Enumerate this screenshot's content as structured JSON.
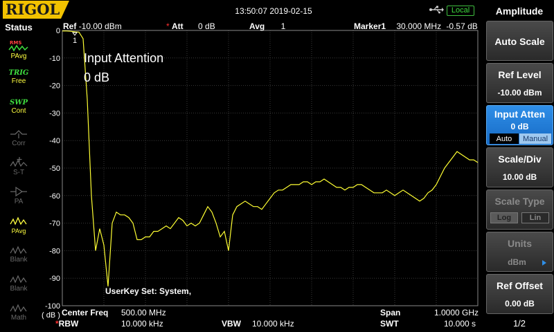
{
  "header": {
    "logo": "RIGOL",
    "datetime": "13:50:07 2019-02-15",
    "local": "Local",
    "ref_label": "Ref",
    "ref_value": "-10.00 dBm",
    "att_label": "Att",
    "att_value": "0 dB",
    "avg_label": "Avg",
    "avg_value": "1",
    "marker_label": "Marker1",
    "marker_freq": "30.000 MHz",
    "marker_amp": "-0.57 dB"
  },
  "status": {
    "title": "Status",
    "items": [
      {
        "top": "",
        "bottom": "PAvg",
        "icon": "rms-wave-icon",
        "active": true
      },
      {
        "top": "TRIG",
        "bottom": "Free",
        "icon": "",
        "active": true
      },
      {
        "top": "SWP",
        "bottom": "Cont",
        "icon": "",
        "active": true
      },
      {
        "top": "",
        "bottom": "Corr",
        "icon": "corr-icon",
        "active": false
      },
      {
        "top": "",
        "bottom": "S-T",
        "icon": "st-icon",
        "active": false
      },
      {
        "top": "",
        "bottom": "PA",
        "icon": "pa-icon",
        "active": false
      },
      {
        "top": "",
        "bottom": "PAvg",
        "icon": "pavg-icon",
        "active": true
      },
      {
        "top": "",
        "bottom": "Blank",
        "icon": "blank-icon",
        "active": false
      },
      {
        "top": "",
        "bottom": "Blank",
        "icon": "blank-icon",
        "active": false
      },
      {
        "top": "",
        "bottom": "Math",
        "icon": "math-icon",
        "active": false
      }
    ],
    "rms_text": "RMS"
  },
  "plot": {
    "y_ticks": [
      "0",
      "-10",
      "-20",
      "-30",
      "-40",
      "-50",
      "-60",
      "-70",
      "-80",
      "-90",
      "-100"
    ],
    "y_unit": "( dB )",
    "marker_num": "1",
    "annotation_title": "Input Attention",
    "annotation_value": "0 dB",
    "userkey": "UserKey Set:   System,"
  },
  "chart_data": {
    "type": "line",
    "ylim": [
      -100,
      0
    ],
    "xlim": [
      0,
      1000
    ],
    "x_unit": "MHz",
    "series": [
      {
        "x": [
          0,
          10,
          20,
          30,
          40,
          50,
          60,
          70,
          80,
          90,
          100,
          110,
          120,
          130,
          140,
          150,
          160,
          170,
          180,
          190,
          200,
          210,
          220,
          230,
          240,
          250,
          260,
          270,
          280,
          290,
          300,
          310,
          320,
          330,
          340,
          350,
          360,
          370,
          380,
          390,
          400,
          410,
          420,
          430,
          440,
          450,
          460,
          470,
          480,
          490,
          500,
          510,
          520,
          530,
          540,
          550,
          560,
          570,
          580,
          590,
          600,
          610,
          620,
          630,
          640,
          650,
          660,
          670,
          680,
          690,
          700,
          710,
          720,
          730,
          740,
          750,
          760,
          770,
          780,
          790,
          800,
          810,
          820,
          830,
          840,
          850,
          860,
          870,
          880,
          890,
          900,
          910,
          920,
          930,
          940,
          950,
          960,
          970,
          980,
          990,
          1000
        ],
        "y": [
          -0.2,
          -0.2,
          -0.3,
          -0.5,
          -0.6,
          -3,
          -25,
          -60,
          -80,
          -72,
          -78,
          -93,
          -70,
          -66,
          -67,
          -67,
          -68,
          -70,
          -76,
          -76,
          -75,
          -75,
          -73,
          -73,
          -72,
          -71,
          -72,
          -70,
          -68,
          -69,
          -71,
          -70,
          -71,
          -70,
          -67,
          -64,
          -66,
          -70,
          -75,
          -73,
          -80,
          -67,
          -64,
          -63,
          -62,
          -63,
          -64,
          -64,
          -65,
          -63,
          -61,
          -59,
          -58,
          -58,
          -57,
          -56,
          -56,
          -56,
          -55,
          -55,
          -56,
          -55,
          -55,
          -54,
          -55,
          -56,
          -57,
          -57,
          -58,
          -57,
          -57,
          -56,
          -56,
          -57,
          -58,
          -59,
          -59,
          -59,
          -58,
          -59,
          -60,
          -59,
          -58,
          -59,
          -60,
          -61,
          -62,
          -61,
          -59,
          -58,
          -56,
          -53,
          -50,
          -48,
          -46,
          -44,
          -45,
          -46,
          -47,
          -47,
          -48
        ]
      }
    ]
  },
  "bottom": {
    "center_label": "Center Freq",
    "center_value": "500.00 MHz",
    "span_label": "Span",
    "span_value": "1.0000 GHz",
    "rbw_label": "RBW",
    "rbw_value": "10.000 kHz",
    "vbw_label": "VBW",
    "vbw_value": "10.000 kHz",
    "swt_label": "SWT",
    "swt_value": "10.000 s"
  },
  "menu": {
    "title": "Amplitude",
    "auto_scale": "Auto Scale",
    "ref_level": "Ref Level",
    "ref_level_value": "-10.00 dBm",
    "input_atten": "Input Atten",
    "input_atten_value": "0 dB",
    "atten_auto": "Auto",
    "atten_manual": "Manual",
    "scale_div": "Scale/Div",
    "scale_div_value": "10.00 dB",
    "scale_type": "Scale Type",
    "scale_log": "Log",
    "scale_lin": "Lin",
    "units": "Units",
    "units_value": "dBm",
    "ref_offset": "Ref Offset",
    "ref_offset_value": "0.00 dB",
    "page": "1/2"
  },
  "colors": {
    "trace": "#ffff33",
    "grid": "#3a3a3a",
    "active_key": "#1e7ad6",
    "logo": "#f2c200"
  }
}
